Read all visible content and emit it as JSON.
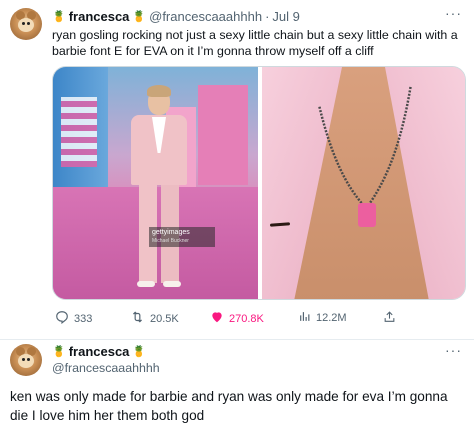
{
  "tweet1": {
    "display_name": "francesca",
    "name_emoji": "🍍",
    "handle": "@francescaaahhhh",
    "separator": "·",
    "date": "Jul 9",
    "more": "···",
    "text": "ryan gosling rocking not just a sexy little chain but a sexy little chain with a barbie font E for EVA on it I’m gonna throw myself off a cliff",
    "image_watermark": "gettyimages",
    "image_watermark_credit": "Michael Buckner",
    "actions": {
      "replies": "333",
      "retweets": "20.5K",
      "likes": "270.8K",
      "views": "12.2M"
    },
    "icons": {
      "reply": "reply-icon",
      "retweet": "retweet-icon",
      "like": "heart-icon",
      "views": "views-icon",
      "share": "share-icon"
    },
    "colors": {
      "like": "#f91880",
      "muted": "#536471"
    }
  },
  "tweet2": {
    "display_name": "francesca",
    "name_emoji": "🍍",
    "handle": "@francescaaahhhh",
    "more": "···",
    "text": "ken was only made for barbie and ryan was only made for eva I’m gonna die I love him her them both god"
  }
}
